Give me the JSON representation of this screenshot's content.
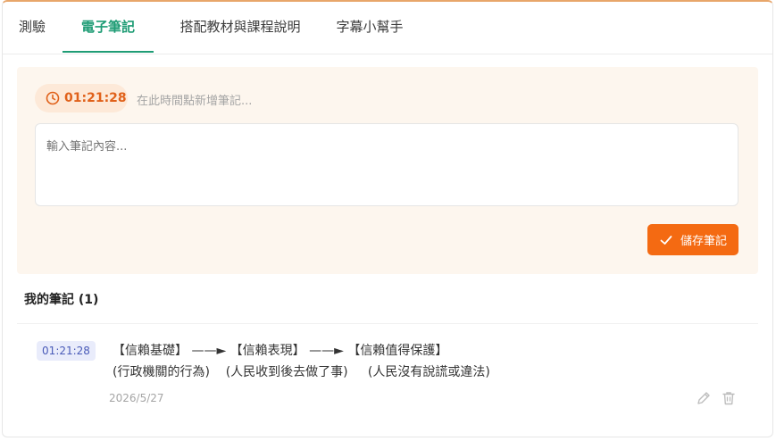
{
  "tabs": [
    {
      "label": "測驗",
      "active": false
    },
    {
      "label": "電子筆記",
      "active": true
    },
    {
      "label": "搭配教材與課程說明",
      "active": false
    },
    {
      "label": "字幕小幫手",
      "active": false
    }
  ],
  "editor": {
    "timestamp": "01:21:28",
    "time_hint": "在此時間點新增筆記...",
    "input_placeholder": "輸入筆記內容...",
    "save_label": "儲存筆記"
  },
  "my_notes": {
    "title": "我的筆記 (1)",
    "items": [
      {
        "time": "01:21:28",
        "line1": "【信賴基礎】 ——► 【信賴表現】 ——► 【信賴值得保護】",
        "line2": "(行政機關的行為)    (人民收到後去做了事)     (人民沒有說謊或違法)",
        "date": "2026/5/27"
      }
    ]
  },
  "colors": {
    "accent_green": "#1f9c75",
    "accent_orange": "#f46a12",
    "editor_bg": "#fdf6ee",
    "time_badge_bg": "#e9ecfb"
  },
  "icons": {
    "time_pill": "clock-icon",
    "save": "check-icon",
    "edit": "pencil-icon",
    "delete": "trash-icon"
  }
}
